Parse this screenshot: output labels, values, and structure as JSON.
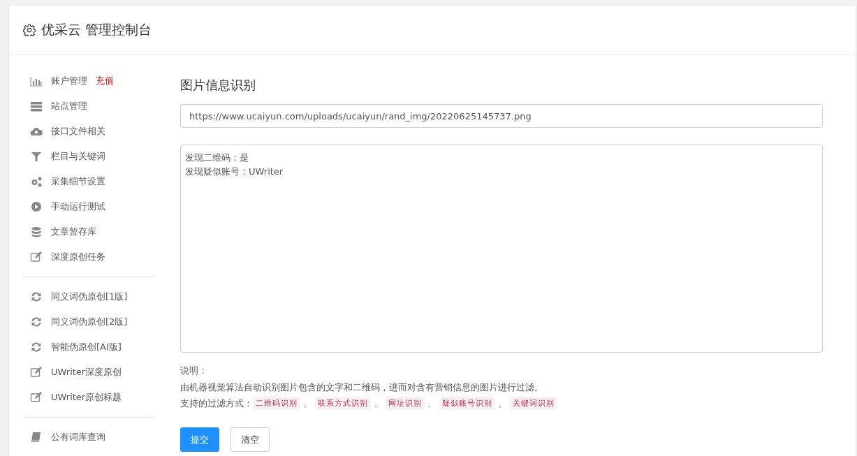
{
  "header": {
    "title": "优采云 管理控制台"
  },
  "sidebar": {
    "groups": [
      [
        {
          "label": "账户管理",
          "badge": "充值"
        },
        {
          "label": "站点管理"
        },
        {
          "label": "接口文件相关"
        },
        {
          "label": "栏目与关键词"
        },
        {
          "label": "采集细节设置"
        },
        {
          "label": "手动运行测试"
        },
        {
          "label": "文章暂存库"
        },
        {
          "label": "深度原创任务"
        }
      ],
      [
        {
          "label": "同义词伪原创[1版]"
        },
        {
          "label": "同义词伪原创[2版]"
        },
        {
          "label": "智能伪原创[AI版]"
        },
        {
          "label": "UWriter深度原创"
        },
        {
          "label": "UWriter原创标题"
        }
      ],
      [
        {
          "label": "公有词库查询"
        }
      ]
    ]
  },
  "main": {
    "title": "图片信息识别",
    "url_field": {
      "value": "https://www.ucaiyun.com/uploads/ucaiyun/rand_img/20220625145737.png"
    },
    "result_box": {
      "lines": [
        "发现二维码：是",
        "发现疑似账号：UWriter"
      ]
    },
    "note_label": "说明：",
    "note_text": "由机器视觉算法自动识别图片包含的文字和二维码，进而对含有营销信息的图片进行过滤。",
    "methods_label": "支持的过滤方式：",
    "methods": [
      {
        "text": "二维码识别",
        "after": "、"
      },
      {
        "text": "联系方式识别",
        "after": "、"
      },
      {
        "text": "网址识别",
        "after": "、"
      },
      {
        "text": "疑似账号识别",
        "after": "、"
      },
      {
        "text": "关键词识别"
      }
    ],
    "buttons": [
      {
        "label": "提交",
        "kind": "primary"
      },
      {
        "label": "清空",
        "kind": "secondary"
      }
    ]
  }
}
